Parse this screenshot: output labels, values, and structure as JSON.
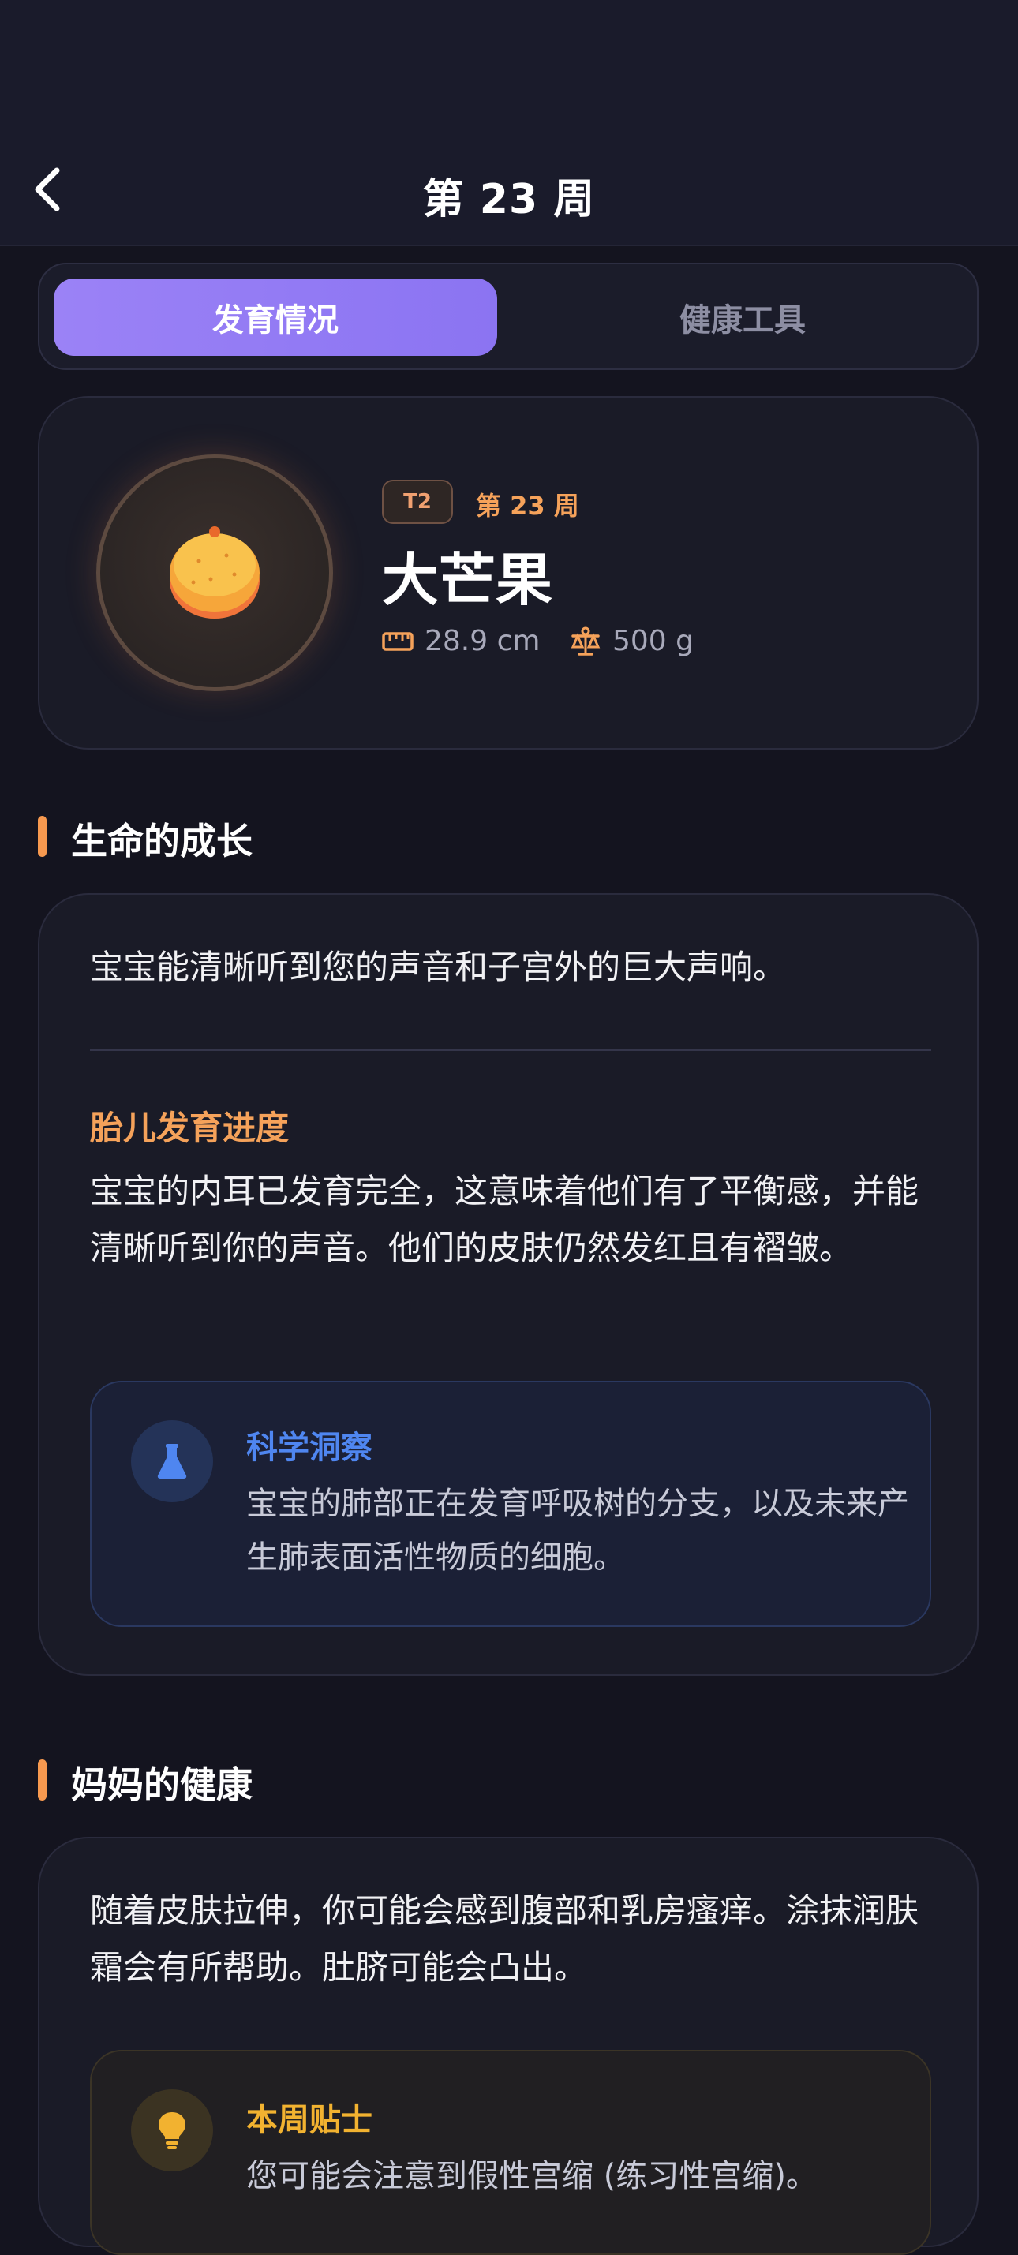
{
  "header": {
    "title": "第 23 周",
    "back_icon": "chevron-left-icon"
  },
  "tabs": [
    {
      "label": "发育情况",
      "active": true
    },
    {
      "label": "健康工具",
      "active": false
    }
  ],
  "hero": {
    "trimester_badge": "T2",
    "week_label": "第 23 周",
    "fruit_name": "大芒果",
    "fruit_icon": "mango-icon",
    "length": "28.9 cm",
    "length_icon": "ruler-icon",
    "weight": "500 g",
    "weight_icon": "scale-icon"
  },
  "life_section": {
    "title": "生命的成长",
    "summary": "宝宝能清晰听到您的声音和子宫外的巨大声响。",
    "progress_title": "胎儿发育进度",
    "progress_text": "宝宝的内耳已发育完全，这意味着他们有了平衡感，并能清晰听到你的声音。他们的皮肤仍然发红且有褶皱。",
    "insight": {
      "title": "科学洞察",
      "text": "宝宝的肺部正在发育呼吸树的分支，以及未来产生肺表面活性物质的细胞。",
      "icon": "flask-icon"
    }
  },
  "health_section": {
    "title": "妈妈的健康",
    "text": "随着皮肤拉伸，你可能会感到腹部和乳房瘙痒。涂抹润肤霜会有所帮助。肚脐可能会凸出。",
    "tip": {
      "title": "本周贴士",
      "text": "您可能会注意到假性宫缩 (练习性宫缩)。",
      "icon": "lightbulb-icon"
    }
  },
  "colors": {
    "accent_purple": "#9b82f6",
    "accent_orange": "#f5a25a",
    "insight_blue": "#4f86f0",
    "tip_yellow": "#f2b230",
    "background": "#14141f"
  }
}
